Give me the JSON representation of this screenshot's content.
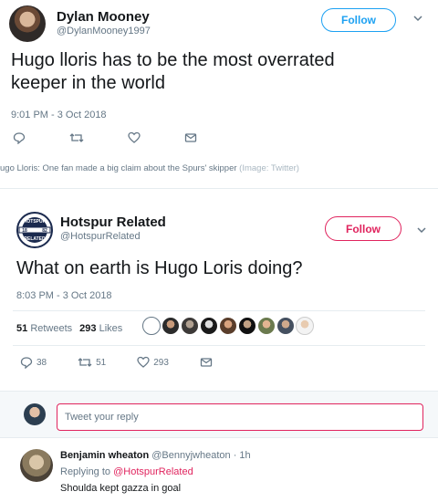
{
  "tweet1": {
    "name": "Dylan Mooney",
    "handle": "@DylanMooney1997",
    "follow_label": "Follow",
    "text_line1": "Hugo lloris has to be the most overrated",
    "text_line2": "keeper in the world",
    "timestamp": "9:01 PM - 3 Oct 2018",
    "caption_main": "ugo Lloris: One fan made a big claim about the Spurs' skipper",
    "caption_credit": "(Image: Twitter)",
    "accent": "#1da1f2"
  },
  "tweet2": {
    "name": "Hotspur Related",
    "handle": "@HotspurRelated",
    "follow_label": "Follow",
    "text": "What on earth is Hugo Loris doing?",
    "timestamp": "8:03 PM - 3 Oct 2018",
    "retweets_count": "51",
    "retweets_label": "Retweets",
    "likes_count": "293",
    "likes_label": "Likes",
    "reply_count": "38",
    "retweet_count": "51",
    "like_count": "293",
    "accent": "#e0245e",
    "logo_text_top": "HOTSPUR",
    "logo_text_bottom": "RELATED",
    "logo_left": "18",
    "logo_right": "82"
  },
  "reply_box": {
    "placeholder": "Tweet your reply"
  },
  "reply": {
    "name": "Benjamin wheaton",
    "handle_time": "@Bennyjwheaton · 1h",
    "replying_prefix": "Replying to",
    "replying_to": "@HotspurRelated",
    "text": "Shoulda kept gazza in goal"
  },
  "icons": [
    "reply-icon",
    "retweet-icon",
    "heart-icon",
    "dm-icon",
    "chevron-down-icon"
  ]
}
